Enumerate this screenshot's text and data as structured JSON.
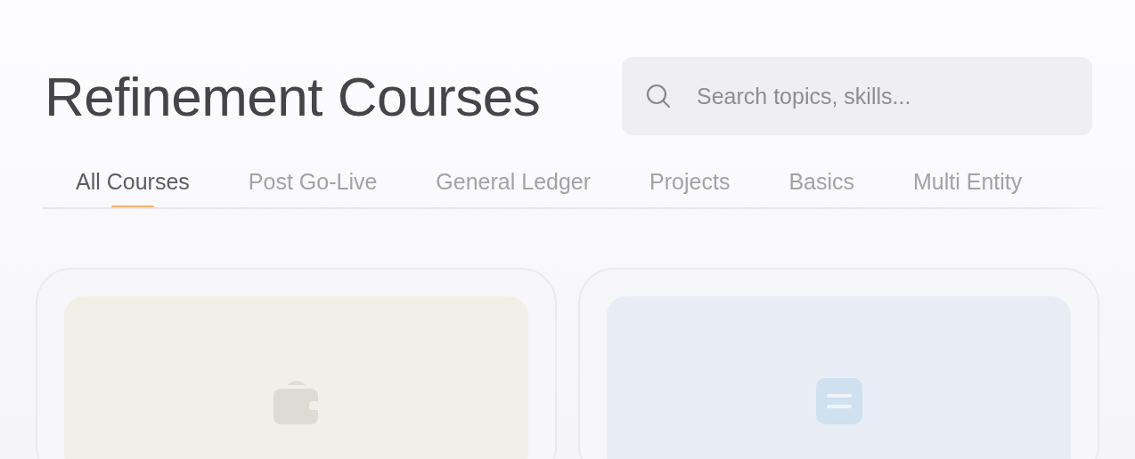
{
  "header": {
    "title": "Refinement Courses"
  },
  "search": {
    "placeholder": "Search topics, skills..."
  },
  "tabs": [
    {
      "label": "All Courses",
      "selected": true
    },
    {
      "label": "Post Go-Live",
      "selected": false
    },
    {
      "label": "General Ledger",
      "selected": false
    },
    {
      "label": "Projects",
      "selected": false
    },
    {
      "label": "Basics",
      "selected": false
    },
    {
      "label": "Multi Entity",
      "selected": false
    }
  ],
  "courses": [
    {
      "kind": "wallet",
      "color": "#f2f0e6"
    },
    {
      "kind": "document",
      "color": "#e8edf5"
    }
  ]
}
